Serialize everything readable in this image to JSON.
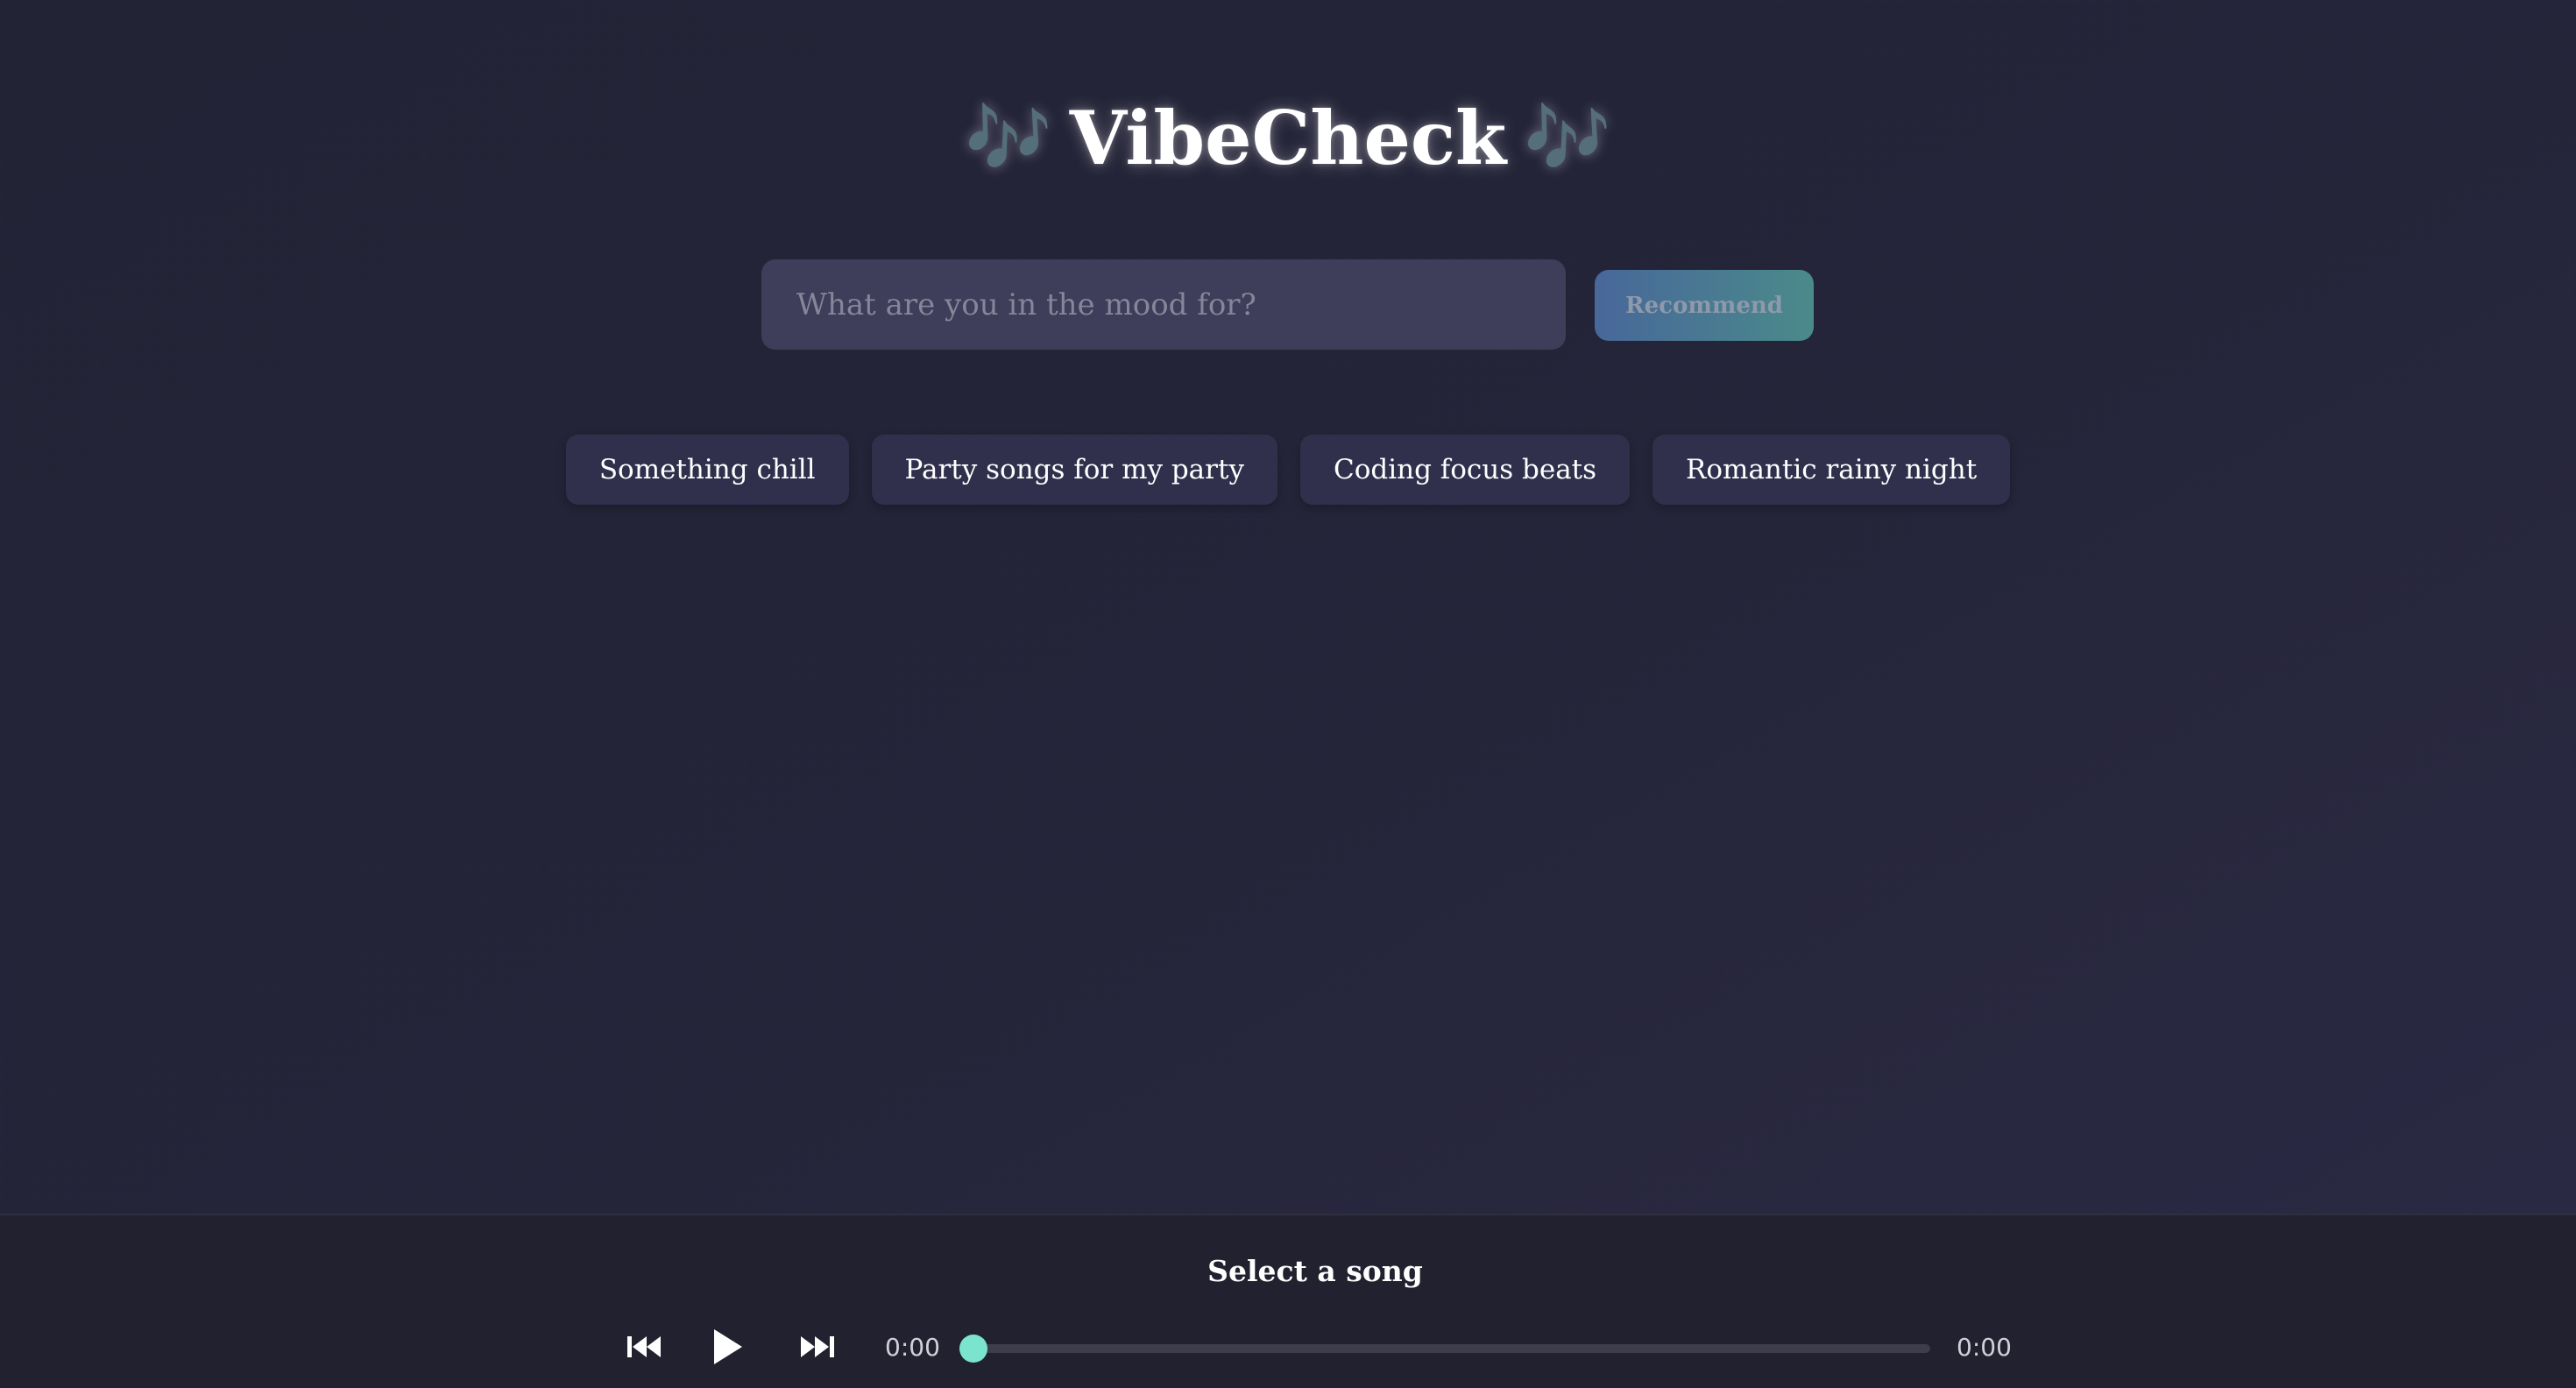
{
  "app": {
    "title": "VibeCheck",
    "title_decoration": "🎶"
  },
  "search": {
    "placeholder": "What are you in the mood for?",
    "value": "",
    "button_label": "Recommend"
  },
  "suggestions": [
    {
      "label": "Something chill"
    },
    {
      "label": "Party songs for my party"
    },
    {
      "label": "Coding focus beats"
    },
    {
      "label": "Romantic rainy night"
    }
  ],
  "player": {
    "now_playing": "Select a song",
    "current_time": "0:00",
    "duration": "0:00",
    "progress": 0,
    "icons": {
      "previous": "skip-previous-icon",
      "play": "play-icon",
      "next": "skip-next-icon"
    }
  },
  "colors": {
    "accent": "#7be4cf",
    "button_gradient_start": "#48679a",
    "button_gradient_end": "#4a8a8a",
    "chip_background": "#30304d",
    "player_background": "#21212f"
  }
}
